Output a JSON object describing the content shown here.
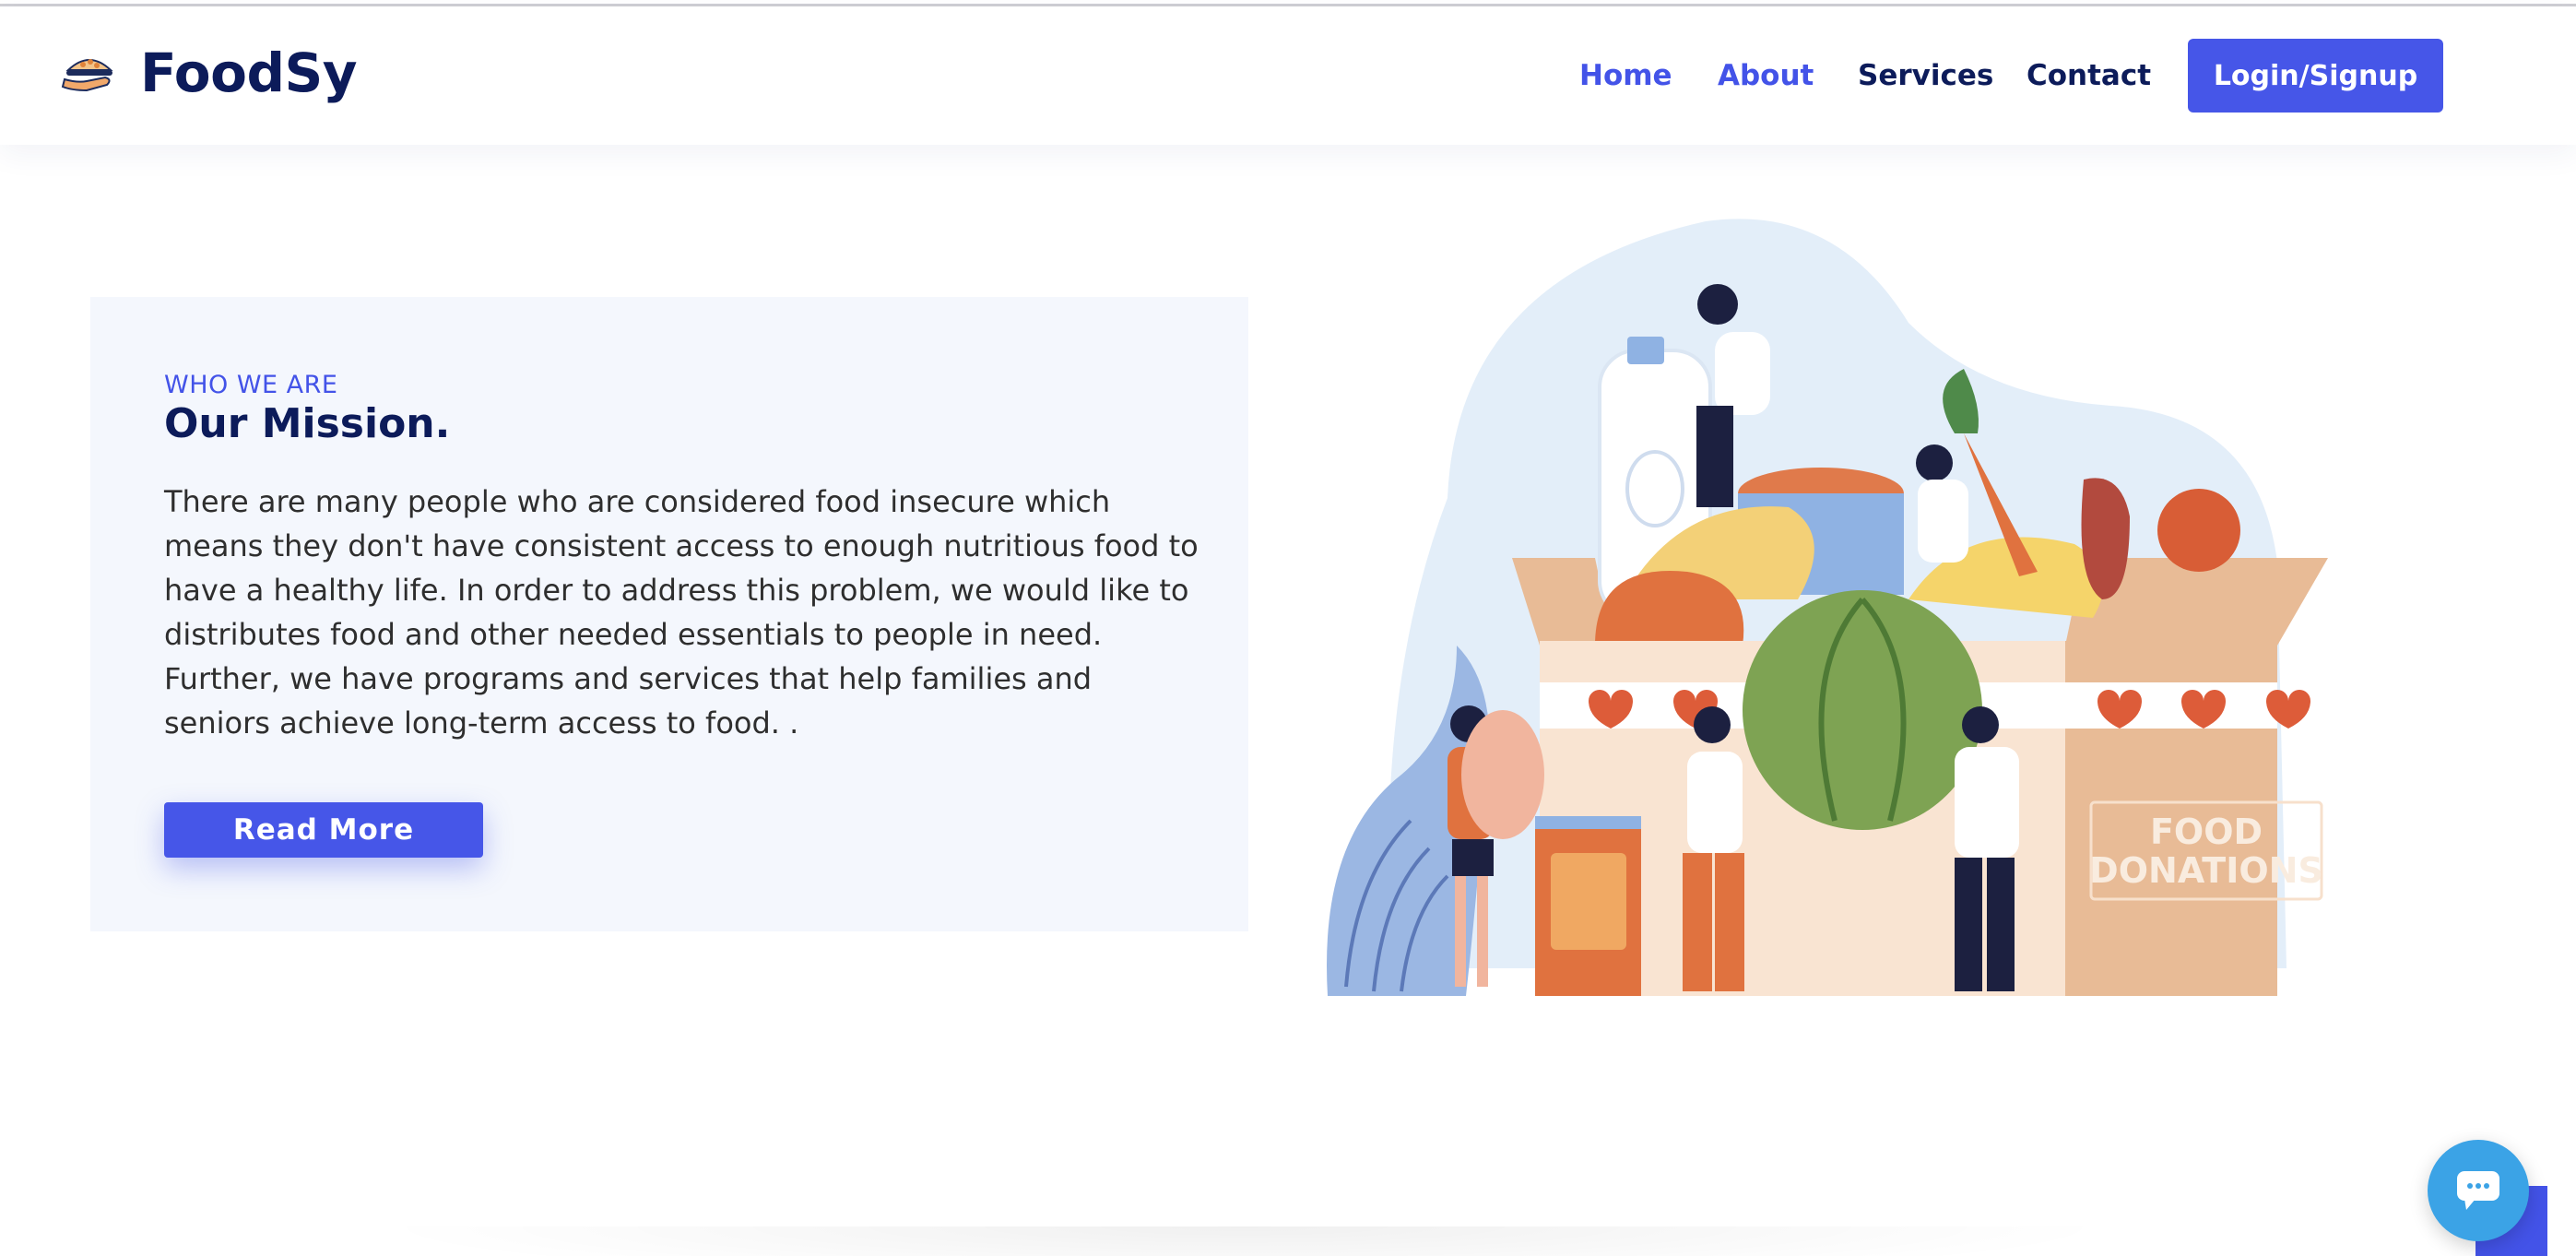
{
  "brand": {
    "name": "FoodSy",
    "icon": "food-bowl-hand-icon"
  },
  "nav": {
    "home": "Home",
    "about": "About",
    "services": "Services",
    "contact": "Contact",
    "login": "Login/Signup"
  },
  "mission": {
    "eyebrow": "WHO WE ARE",
    "title": "Our Mission.",
    "text": "There are many people who are considered food insecure which means they don't have consistent access to enough nutritious food to have a healthy life. In order to address this problem, we would like to distributes food and other needed essentials to people in need. Further, we have programs and services that help families and seniors achieve long-term access to food. .",
    "button": "Read More"
  },
  "illustration": {
    "box_label_line1": "FOOD",
    "box_label_line2": "DONATIONS"
  },
  "colors": {
    "accent": "#4656e8",
    "navy": "#0c1b5a",
    "card_bg": "#f4f7fd",
    "chat": "#3ba3e6"
  },
  "widgets": {
    "chat_icon": "chat-bubble-icon",
    "back_to_top_icon": "arrow-up-icon"
  }
}
